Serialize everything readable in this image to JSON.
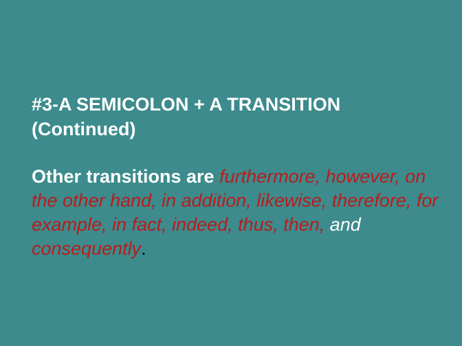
{
  "slide": {
    "title_line1": "#3-A SEMICOLON + A TRANSITION",
    "title_line2": "(Continued)",
    "body": {
      "lead": "Other transitions are ",
      "list_part1": "furthermore, however, on the other hand, in addition, likewise, therefore, for example, in fact, indeed, thus, then,",
      "and_word": " and ",
      "last_item": "consequently",
      "period": "."
    }
  },
  "colors": {
    "background": "#3d8b8c",
    "title": "#ffffff",
    "transition_words": "#b91c1c"
  }
}
